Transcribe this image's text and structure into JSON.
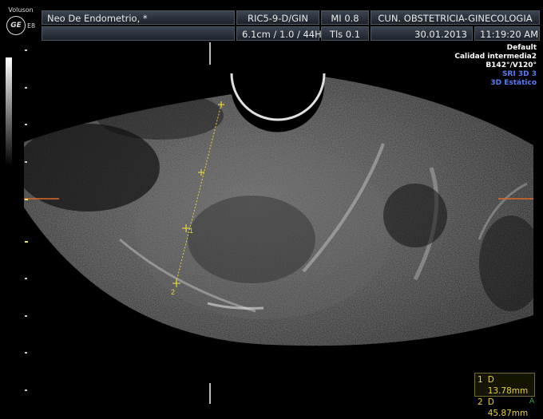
{
  "header": {
    "brand": "Voluson",
    "logo": "GE",
    "model": "E8",
    "patient": "Neo De Endometrio, *",
    "probe": "RIC5-9-D/GIN",
    "mi": "MI  0.8",
    "institution": "CUN. OBSTETRICIA-GINECOLOGIA",
    "depth_freq": "6.1cm / 1.0 / 44Hz",
    "tis": "Tls  0.1",
    "date": "30.01.2013",
    "time": "11:19:20 AM"
  },
  "right_info": {
    "line1": "Default",
    "line2": "Calidad intermedia2",
    "line3": "B142°/V120°",
    "line4": "SRI 3D 3",
    "line5": "3D Estático"
  },
  "caliper_labels": {
    "c1": "1",
    "c2": "2"
  },
  "measurements": [
    {
      "n": "1",
      "text": "D 13.78mm"
    },
    {
      "n": "2",
      "text": "D 45.87mm"
    }
  ],
  "corner": "A",
  "colors": {
    "caliper": "#e6d23a",
    "marker_orange": "#d86a2a",
    "accent_blue": "#5a7df0"
  }
}
